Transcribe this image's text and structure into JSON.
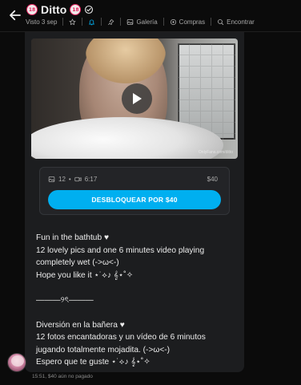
{
  "header": {
    "title": "Ditto",
    "badge_text": "18",
    "last_seen": "Visto 3 sep",
    "gallery_label": "Galería",
    "purchases_label": "Compras",
    "search_label": "Encontrar"
  },
  "post": {
    "watermark": "OnlyFans.com/ditto",
    "photo_count": "12",
    "video_duration": "6:17",
    "price": "$40",
    "unlock_label": "DESBLOQUEAR POR $40",
    "text_lines": [
      "Fun in the bathtub ♥",
      "12 lovely pics and one 6 minutes video playing",
      "completely wet (->ω<-)",
      "Hope you like it ⋆˙⟡♪ 𝄞⋆˚✧",
      "",
      "———୨ৎ———",
      "",
      "Diversión en la bañera ♥",
      "12 fotos encantadoras y un vídeo de 6 minutos",
      "jugando totalmente mojadita. (->ω<-)",
      "Espero que te guste ⋆˙⟡♪ 𝄞⋆˚✧"
    ]
  },
  "footer": {
    "meta": "15:51, $40 aún no pagado"
  }
}
